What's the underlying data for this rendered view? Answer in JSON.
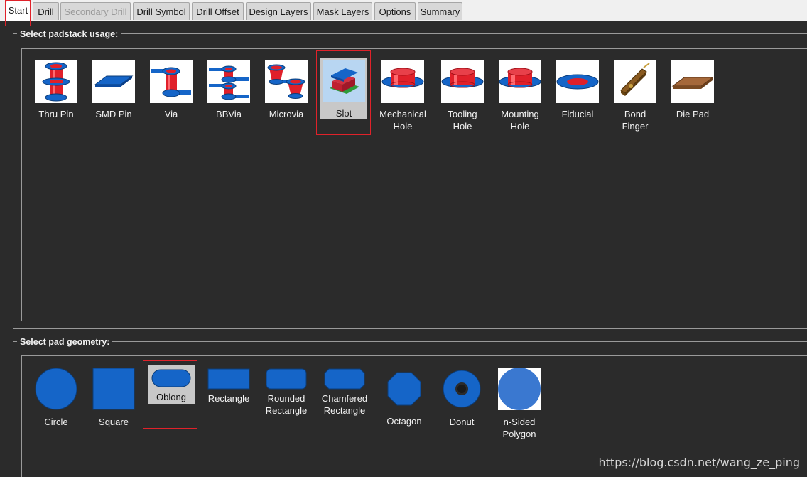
{
  "tabs": [
    {
      "label": "Start",
      "state": "active"
    },
    {
      "label": "Drill",
      "state": "normal"
    },
    {
      "label": "Secondary Drill",
      "state": "disabled"
    },
    {
      "label": "Drill Symbol",
      "state": "normal"
    },
    {
      "label": "Drill Offset",
      "state": "normal"
    },
    {
      "label": "Design Layers",
      "state": "normal"
    },
    {
      "label": "Mask Layers",
      "state": "normal"
    },
    {
      "label": "Options",
      "state": "normal"
    },
    {
      "label": "Summary",
      "state": "normal"
    }
  ],
  "usage": {
    "title": "Select padstack usage:",
    "selected": "Slot",
    "items": [
      {
        "label": "Thru Pin",
        "icon": "thru-pin-icon"
      },
      {
        "label": "SMD Pin",
        "icon": "smd-pin-icon"
      },
      {
        "label": "Via",
        "icon": "via-icon"
      },
      {
        "label": "BBVia",
        "icon": "bbvia-icon"
      },
      {
        "label": "Microvia",
        "icon": "microvia-icon"
      },
      {
        "label": "Slot",
        "icon": "slot-icon"
      },
      {
        "label": "Mechanical\nHole",
        "icon": "mechanical-hole-icon"
      },
      {
        "label": "Tooling\nHole",
        "icon": "tooling-hole-icon"
      },
      {
        "label": "Mounting\nHole",
        "icon": "mounting-hole-icon"
      },
      {
        "label": "Fiducial",
        "icon": "fiducial-icon"
      },
      {
        "label": "Bond\nFinger",
        "icon": "bond-finger-icon"
      },
      {
        "label": "Die Pad",
        "icon": "die-pad-icon"
      }
    ]
  },
  "geometry": {
    "title": "Select pad geometry:",
    "selected": "Oblong",
    "items": [
      {
        "label": "Circle",
        "icon": "circle-shape-icon"
      },
      {
        "label": "Square",
        "icon": "square-shape-icon"
      },
      {
        "label": "Oblong",
        "icon": "oblong-shape-icon"
      },
      {
        "label": "Rectangle",
        "icon": "rectangle-shape-icon"
      },
      {
        "label": "Rounded\nRectangle",
        "icon": "rounded-rectangle-shape-icon"
      },
      {
        "label": "Chamfered\nRectangle",
        "icon": "chamfered-rectangle-shape-icon"
      },
      {
        "label": "Octagon",
        "icon": "octagon-shape-icon"
      },
      {
        "label": "Donut",
        "icon": "donut-shape-icon"
      },
      {
        "label": "n-Sided\nPolygon",
        "icon": "n-sided-polygon-shape-icon"
      }
    ]
  },
  "colors": {
    "pad_blue": "#1565c8",
    "barrel_red": "#e0202a",
    "highlight": "#e0222a",
    "background": "#2b2b2b"
  },
  "watermark": "https://blog.csdn.net/wang_ze_ping"
}
